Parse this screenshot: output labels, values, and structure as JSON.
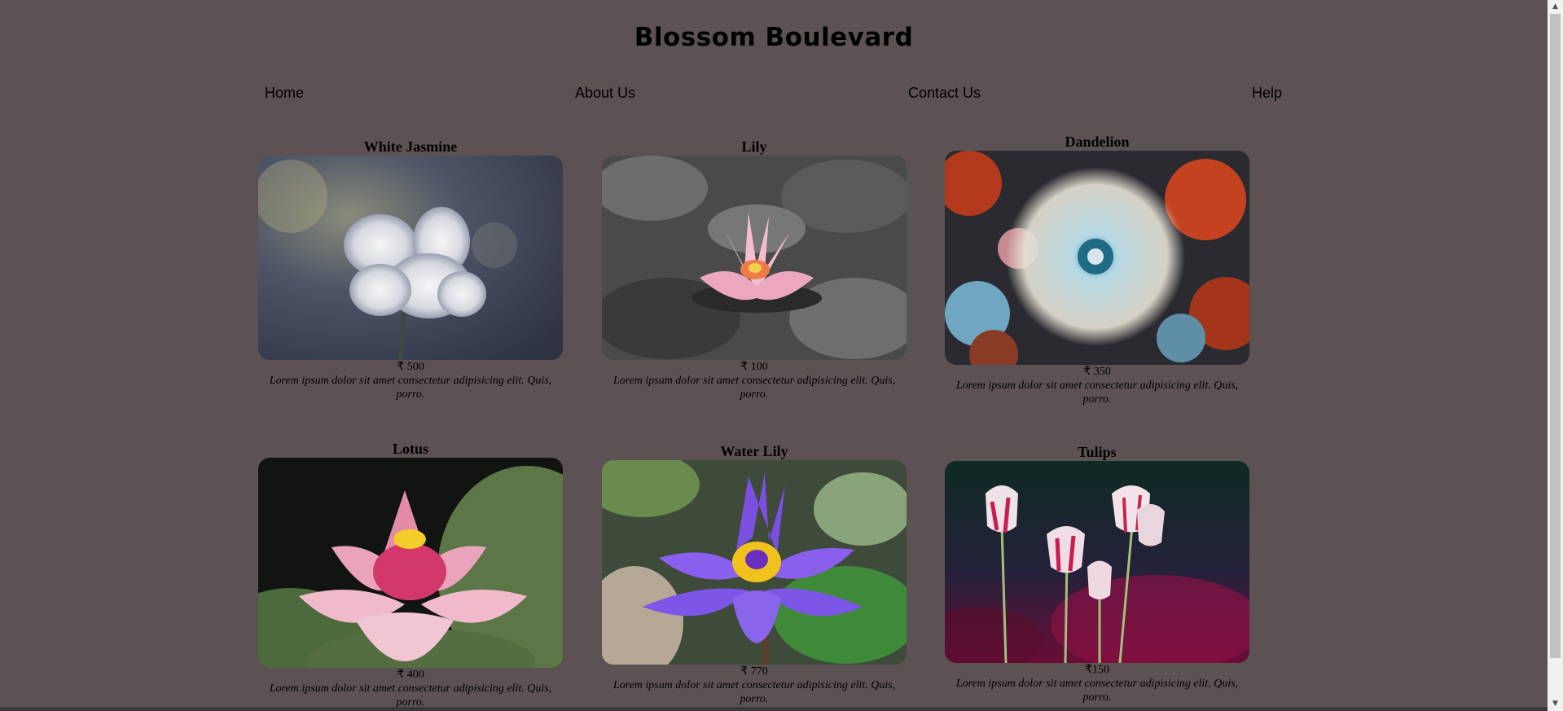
{
  "header": {
    "title": "Blossom Boulevard"
  },
  "nav": {
    "items": [
      {
        "label": "Home"
      },
      {
        "label": "About Us"
      },
      {
        "label": "Contact Us"
      },
      {
        "label": "Help"
      }
    ]
  },
  "products": [
    {
      "name": "White Jasmine",
      "price": "₹ 500",
      "description": "Lorem ipsum dolor sit amet consectetur adipisicing elit. Quis, porro."
    },
    {
      "name": "Lily",
      "price": "₹ 100",
      "description": "Lorem ipsum dolor sit amet consectetur adipisicing elit. Quis, porro."
    },
    {
      "name": "Dandelion",
      "price": "₹ 350",
      "description": "Lorem ipsum dolor sit amet consectetur adipisicing elit. Quis, porro."
    },
    {
      "name": "Lotus",
      "price": "₹ 400",
      "description": "Lorem ipsum dolor sit amet consectetur adipisicing elit. Quis, porro."
    },
    {
      "name": "Water Lily",
      "price": "₹ 770",
      "description": "Lorem ipsum dolor sit amet consectetur adipisicing elit. Quis, porro."
    },
    {
      "name": "Tulips",
      "price": "₹150",
      "description": "Lorem ipsum dolor sit amet consectetur adipisicing elit. Quis, porro."
    }
  ],
  "colors": {
    "background": "#5c5254",
    "scrollbar_track": "#f1f1f1",
    "scrollbar_thumb": "#c1c1c1"
  },
  "icons": {
    "scroll_up": "scroll-up-arrow-icon",
    "scroll_down": "scroll-down-arrow-icon"
  }
}
